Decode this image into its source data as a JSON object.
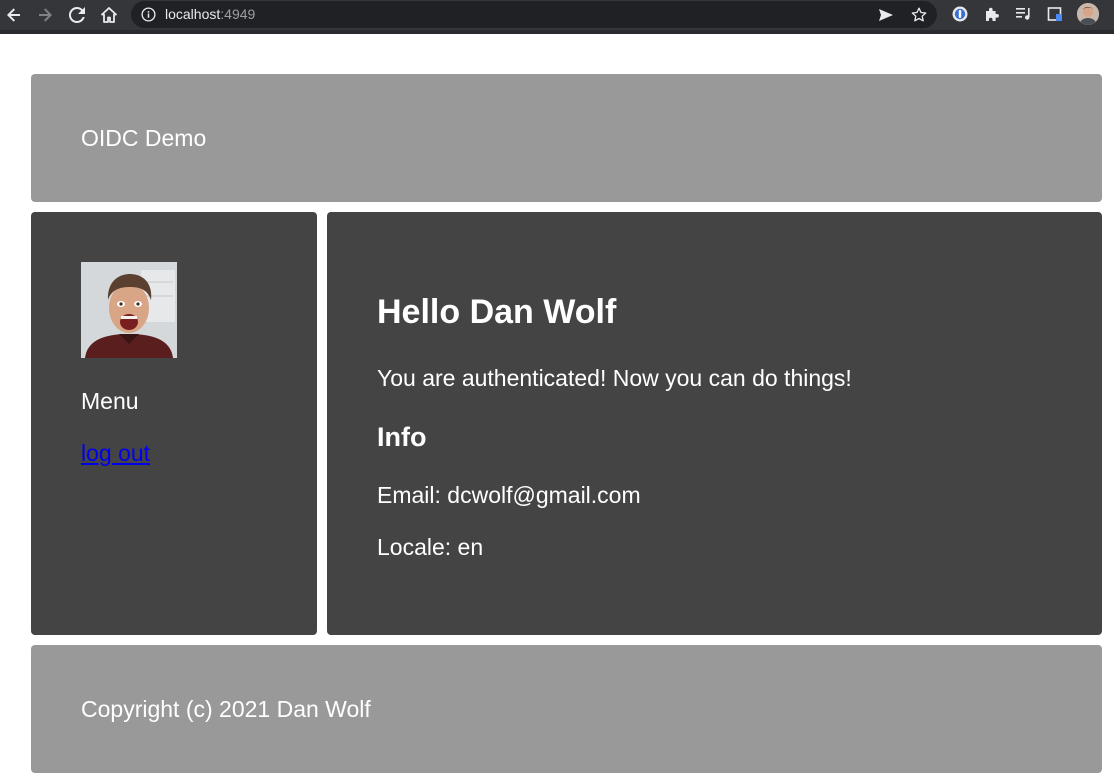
{
  "browser": {
    "url_host": "localhost",
    "url_port": ":4949"
  },
  "header": {
    "title": "OIDC Demo"
  },
  "sidebar": {
    "menu_label": "Menu",
    "logout_label": "log out"
  },
  "main": {
    "greeting": "Hello Dan Wolf",
    "auth_message": "You are authenticated! Now you can do things!",
    "info_heading": "Info",
    "email_line": "Email: dcwolf@gmail.com",
    "locale_line": "Locale: en"
  },
  "footer": {
    "copyright": "Copyright (c) 2021 Dan Wolf"
  },
  "colors": {
    "header_footer_bg": "#999999",
    "panel_bg": "#444444",
    "link": "#0000ee",
    "chrome_bg": "#35363a"
  }
}
